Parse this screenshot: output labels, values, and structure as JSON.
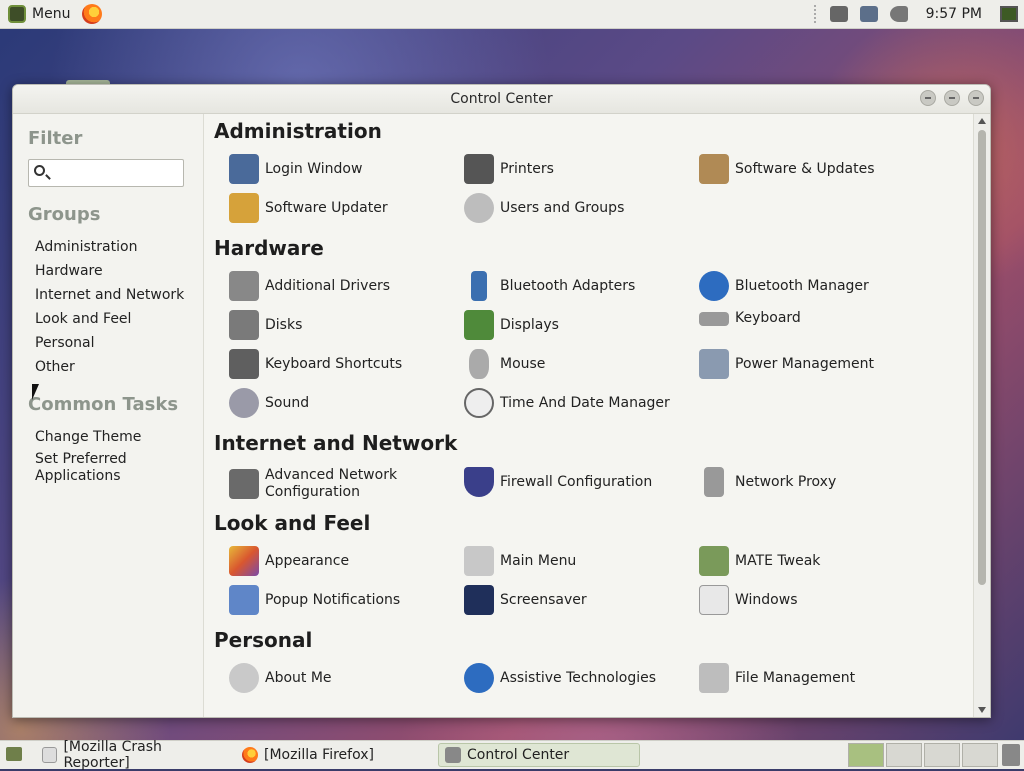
{
  "top_panel": {
    "menu_label": "Menu",
    "clock": "9:57 PM"
  },
  "window": {
    "title": "Control Center"
  },
  "sidebar": {
    "filter_heading": "Filter",
    "search_placeholder": "",
    "groups_heading": "Groups",
    "groups": [
      "Administration",
      "Hardware",
      "Internet and Network",
      "Look and Feel",
      "Personal",
      "Other"
    ],
    "tasks_heading": "Common Tasks",
    "tasks": [
      "Change Theme",
      "Set Preferred Applications"
    ]
  },
  "main": {
    "groups": [
      {
        "title": "Administration",
        "items": [
          "Login Window",
          "Printers",
          "Software & Updates",
          "Software Updater",
          "Users and Groups"
        ]
      },
      {
        "title": "Hardware",
        "items": [
          "Additional Drivers",
          "Bluetooth Adapters",
          "Bluetooth Manager",
          "Disks",
          "Displays",
          "Keyboard",
          "Keyboard Shortcuts",
          "Mouse",
          "Power Management",
          "Sound",
          "Time And Date Manager"
        ]
      },
      {
        "title": "Internet and Network",
        "items": [
          "Advanced Network Configuration",
          "Firewall Configuration",
          "Network Proxy"
        ]
      },
      {
        "title": "Look and Feel",
        "items": [
          "Appearance",
          "Main Menu",
          "MATE Tweak",
          "Popup Notifications",
          "Screensaver",
          "Windows"
        ]
      },
      {
        "title": "Personal",
        "items": [
          "About Me",
          "Assistive Technologies",
          "File Management"
        ]
      }
    ]
  },
  "taskbar": {
    "tasks": [
      "[Mozilla Crash Reporter]",
      "[Mozilla Firefox]",
      "Control Center"
    ]
  },
  "colors": {
    "accent": "#a8c080",
    "heading_gray": "#8d958c"
  }
}
